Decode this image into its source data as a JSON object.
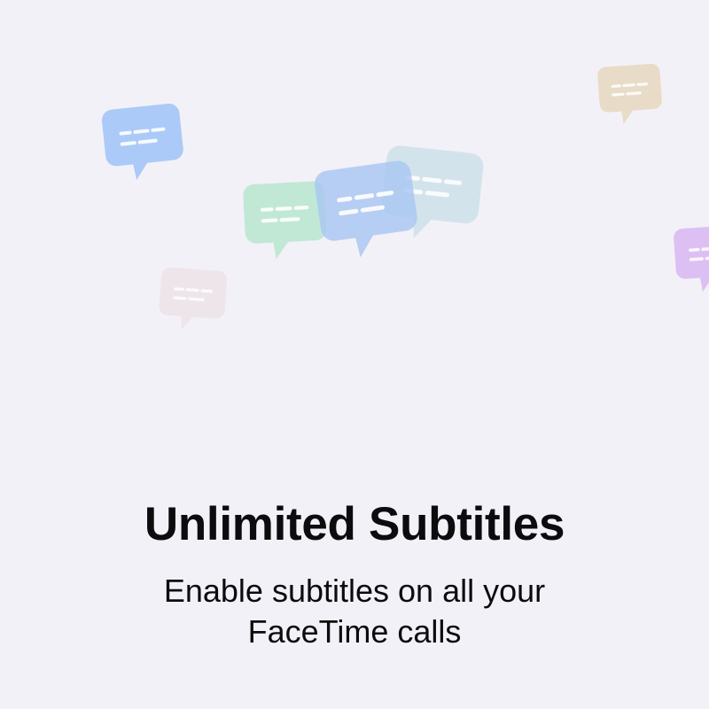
{
  "onboarding": {
    "title": "Unlimited Subtitles",
    "description": "Enable subtitles on all your FaceTime calls"
  },
  "bubbles": [
    {
      "icon": "chat-bubble-icon",
      "color": "#9fc3f7"
    },
    {
      "icon": "chat-bubble-icon",
      "color": "#e7d9c2"
    },
    {
      "icon": "chat-bubble-icon",
      "color": "#b7e6cf"
    },
    {
      "icon": "chat-bubble-icon",
      "color": "#a7c6f3"
    },
    {
      "icon": "chat-bubble-icon",
      "color": "#c8dee8"
    },
    {
      "icon": "chat-bubble-icon",
      "color": "#ece3e8"
    },
    {
      "icon": "chat-bubble-icon",
      "color": "#d8b7f2"
    }
  ]
}
